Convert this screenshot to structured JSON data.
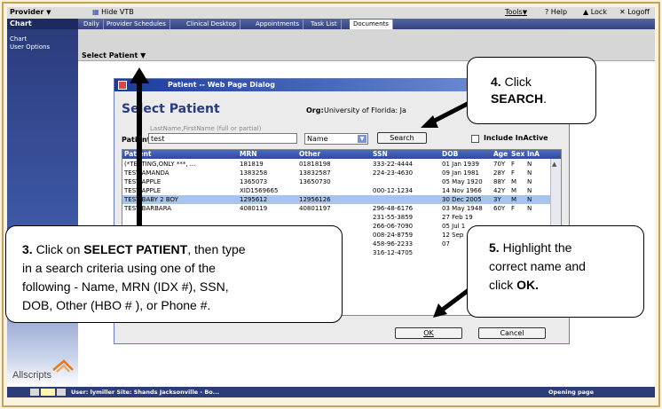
{
  "topbar": {
    "provider_label": "Provider",
    "hide_label": "Hide VTB",
    "tools_label": "Tools",
    "help_label": "Help",
    "lock_label": "Lock",
    "logoff_label": "Logoff"
  },
  "sidebar": {
    "title": "Chart",
    "items": [
      {
        "label": "Chart"
      },
      {
        "label": "User Options"
      }
    ],
    "logo_text": "Allscripts"
  },
  "tabs": [
    {
      "label": "Daily"
    },
    {
      "label": "Provider Schedules"
    },
    {
      "label": "Clinical Desktop"
    },
    {
      "label": "Appointments"
    },
    {
      "label": "Task List"
    },
    {
      "label": "Documents"
    }
  ],
  "subbar": {
    "select_patient_label": "Select Patient"
  },
  "dialog": {
    "title": "Patient -- Web Page Dialog",
    "heading": "Select Patient",
    "org_label": "Org:",
    "org_value": "University of Florida: Ja",
    "hint": "LastName,FirstName (full or partial)",
    "patient_label": "Patient:",
    "patient_value": "test",
    "search_type": "Name",
    "search_button": "Search",
    "include_inactive_label": "Include InActive",
    "ok_button": "OK",
    "cancel_button": "Cancel",
    "columns": [
      "Patient",
      "MRN",
      "Other",
      "SSN",
      "DOB",
      "Age",
      "Sex",
      "InA"
    ],
    "rows": [
      {
        "patient": "(*TESTING,ONLY ***, ...",
        "mrn": "181819",
        "other": "01818198",
        "ssn": "333-22-4444",
        "dob": "01 Jan 1939",
        "age": "70Y",
        "sex": "F",
        "ina": "N"
      },
      {
        "patient": "TEST,AMANDA",
        "mrn": "1383258",
        "other": "13832587",
        "ssn": "224-23-4630",
        "dob": "09 Jan 1981",
        "age": "28Y",
        "sex": "F",
        "ina": "N"
      },
      {
        "patient": "TEST,APPLE",
        "mrn": "1365073",
        "other": "13650730",
        "ssn": "",
        "dob": "05 May 1920",
        "age": "88Y",
        "sex": "M",
        "ina": "N"
      },
      {
        "patient": "TEST,APPLE",
        "mrn": "XID1569665",
        "other": "",
        "ssn": "000-12-1234",
        "dob": "14 Nov 1966",
        "age": "42Y",
        "sex": "M",
        "ina": "N"
      },
      {
        "patient": "TEST,BABY 2 BOY",
        "mrn": "1295612",
        "other": "12956126",
        "ssn": "",
        "dob": "30 Dec 2005",
        "age": "3Y",
        "sex": "M",
        "ina": "N"
      },
      {
        "patient": "TEST,BARBARA",
        "mrn": "4080119",
        "other": "40801197",
        "ssn": "296-48-6176",
        "dob": "03 May 1948",
        "age": "60Y",
        "sex": "F",
        "ina": "N"
      },
      {
        "patient": "",
        "mrn": "",
        "other": "",
        "ssn": "231-55-3859",
        "dob": "27 Feb 19",
        "age": "",
        "sex": "",
        "ina": ""
      },
      {
        "patient": "",
        "mrn": "",
        "other": "",
        "ssn": "266-06-7090",
        "dob": "05 Jul 1",
        "age": "",
        "sex": "",
        "ina": ""
      },
      {
        "patient": "",
        "mrn": "",
        "other": "",
        "ssn": "008-24-8759",
        "dob": "12 Sep",
        "age": "",
        "sex": "",
        "ina": ""
      },
      {
        "patient": "",
        "mrn": "",
        "other": "",
        "ssn": "458-96-2233",
        "dob": "07",
        "age": "",
        "sex": "",
        "ina": ""
      },
      {
        "patient": "",
        "mrn": "",
        "other": "",
        "ssn": "316-12-4705",
        "dob": "",
        "age": "",
        "sex": "",
        "ina": ""
      }
    ]
  },
  "statusbar": {
    "user_text": "User: lymiller  Site: Shands Jacksonville - Bo...",
    "right_text": "Opening page http://asweb.ufjx..."
  },
  "callouts": {
    "c4_num": "4.",
    "c4_text1": " Click",
    "c4_bold": "SEARCH",
    "c4_end": ".",
    "c3_num": "3.",
    "c3_pre": " Click on ",
    "c3_bold": "SELECT PATIENT",
    "c3_rest1": ", then type",
    "c3_line2": "in a search criteria using one of the",
    "c3_line3": "following - Name, MRN (IDX #), SSN,",
    "c3_line4": "DOB, Other (HBO # ), or Phone #.",
    "c5_num": "5.",
    "c5_line1": " Highlight the",
    "c5_line2": "correct name and",
    "c5_line3": "click ",
    "c5_bold": "OK."
  }
}
